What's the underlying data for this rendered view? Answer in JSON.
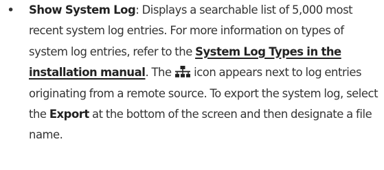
{
  "bullet_glyph": "•",
  "item": {
    "term": "Show System Log",
    "t1": ": Displays a searchable list of 5,000 most recent system log entries. For more information on types of system log entries, refer to the ",
    "link_text": "System Log Types in the installation manual",
    "t2": ". The ",
    "icon": "network-topology-icon",
    "t3": " icon appears next to log entries originating from a remote source. To export the system log, select the ",
    "export_label": "Export",
    "t4": " at the bottom of the screen and then designate a file name."
  },
  "colors": {
    "text": "#333333",
    "emphasis": "#222222",
    "icon": "#222222"
  }
}
